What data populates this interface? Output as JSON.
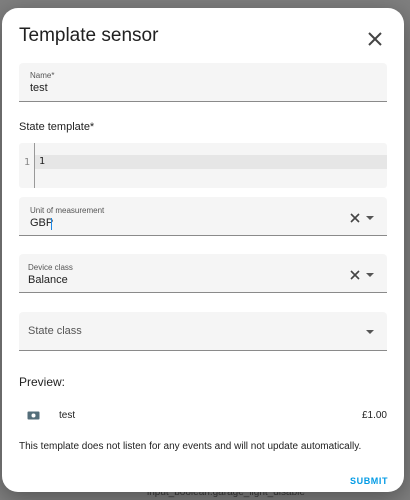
{
  "background": {
    "partial_text": "input_boolean.garage_light_disable"
  },
  "dialog": {
    "title": "Template sensor",
    "close_icon": "close-icon"
  },
  "fields": {
    "name": {
      "label": "Name*",
      "value": "test"
    },
    "state_template": {
      "label": "State template*",
      "line_number": "1",
      "code": "1"
    },
    "unit_of_measurement": {
      "label": "Unit of measurement",
      "value": "GBP"
    },
    "device_class": {
      "label": "Device class",
      "value": "Balance"
    },
    "state_class": {
      "label": "State class",
      "value": ""
    }
  },
  "preview": {
    "label": "Preview:",
    "icon": "cash-icon",
    "entity_name": "test",
    "entity_value": "£1.00",
    "note": "This template does not listen for any events and will not update automatically."
  },
  "actions": {
    "submit_label": "SUBMIT"
  },
  "colors": {
    "accent": "#039be5",
    "field_bg": "#f5f5f5"
  }
}
